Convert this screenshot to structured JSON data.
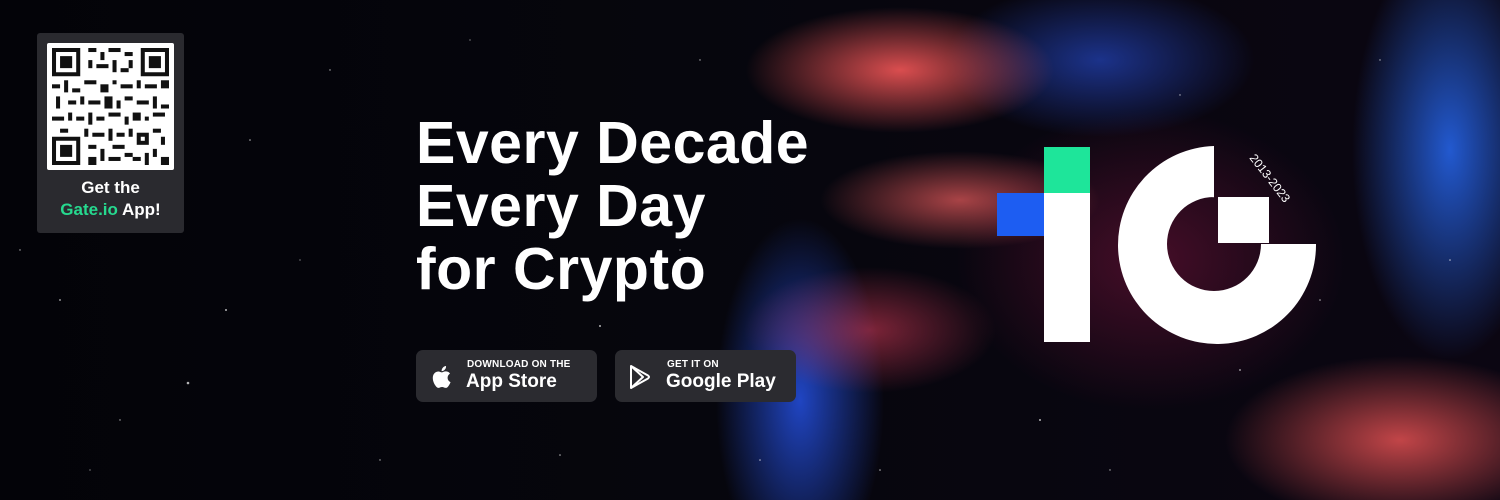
{
  "qr": {
    "line1": "Get the",
    "brand": "Gate.io",
    "line2_rest": " App!"
  },
  "headline": {
    "lines": [
      "Every Decade",
      "Every Day",
      "for Crypto"
    ]
  },
  "stores": {
    "apple": {
      "small": "DOWNLOAD ON THE",
      "big": "App Store",
      "icon": "apple-icon"
    },
    "google": {
      "small": "GET IT ON",
      "big": "Google Play",
      "icon": "google-play-icon"
    }
  },
  "logo": {
    "years": "2013-2023",
    "colors": {
      "green": "#1ee59a",
      "blue": "#1d5df2",
      "white": "#ffffff"
    }
  },
  "colors": {
    "brand_green": "#26d98f",
    "button_bg": "#2b2b30"
  }
}
